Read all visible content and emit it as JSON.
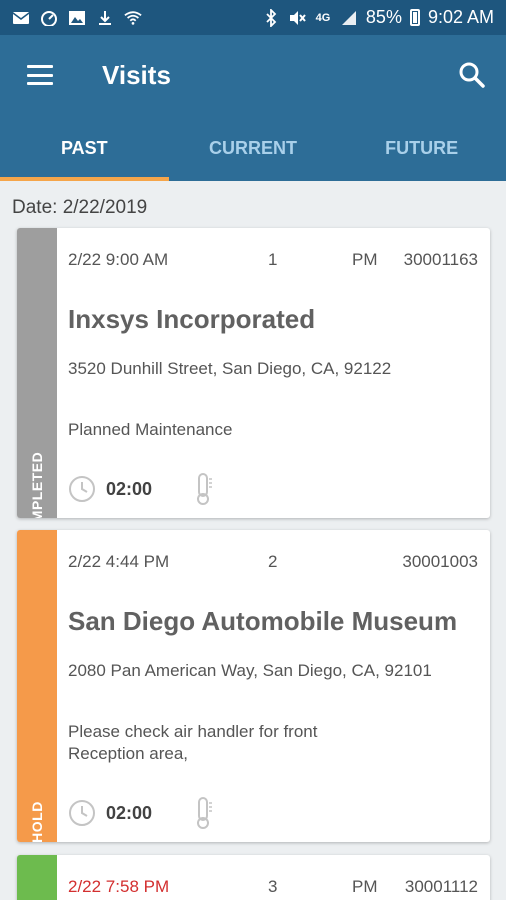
{
  "status_bar": {
    "battery": "85%",
    "time": "9:02 AM",
    "network": "4G"
  },
  "app_bar": {
    "title": "Visits"
  },
  "tabs": [
    {
      "label": "PAST",
      "active": true
    },
    {
      "label": "CURRENT",
      "active": false
    },
    {
      "label": "FUTURE",
      "active": false
    }
  ],
  "date_header": "Date: 2/22/2019",
  "visits": [
    {
      "status": "COMPLETED",
      "status_color": "#9e9e9e",
      "time": "2/22 9:00 AM",
      "sequence": "1",
      "type": "PM",
      "number": "30001163",
      "company": "Inxsys Incorporated",
      "address": "3520 Dunhill Street, San Diego, CA, 92122",
      "description": "Planned Maintenance",
      "duration": "02:00"
    },
    {
      "status": "HOLD",
      "status_color": "#f59a4a",
      "time": "2/22 4:44 PM",
      "sequence": "2",
      "type": "",
      "number": "30001003",
      "company": "San Diego Automobile Museum",
      "address": "2080 Pan American Way, San Diego, CA, 92101",
      "description": "Please check air handler for front Reception area,",
      "duration": "02:00"
    },
    {
      "status": "",
      "status_color": "#6dbb4e",
      "time": "2/22 7:58 PM",
      "time_color": "#d32f2f",
      "sequence": "3",
      "type": "PM",
      "number": "30001112"
    }
  ]
}
